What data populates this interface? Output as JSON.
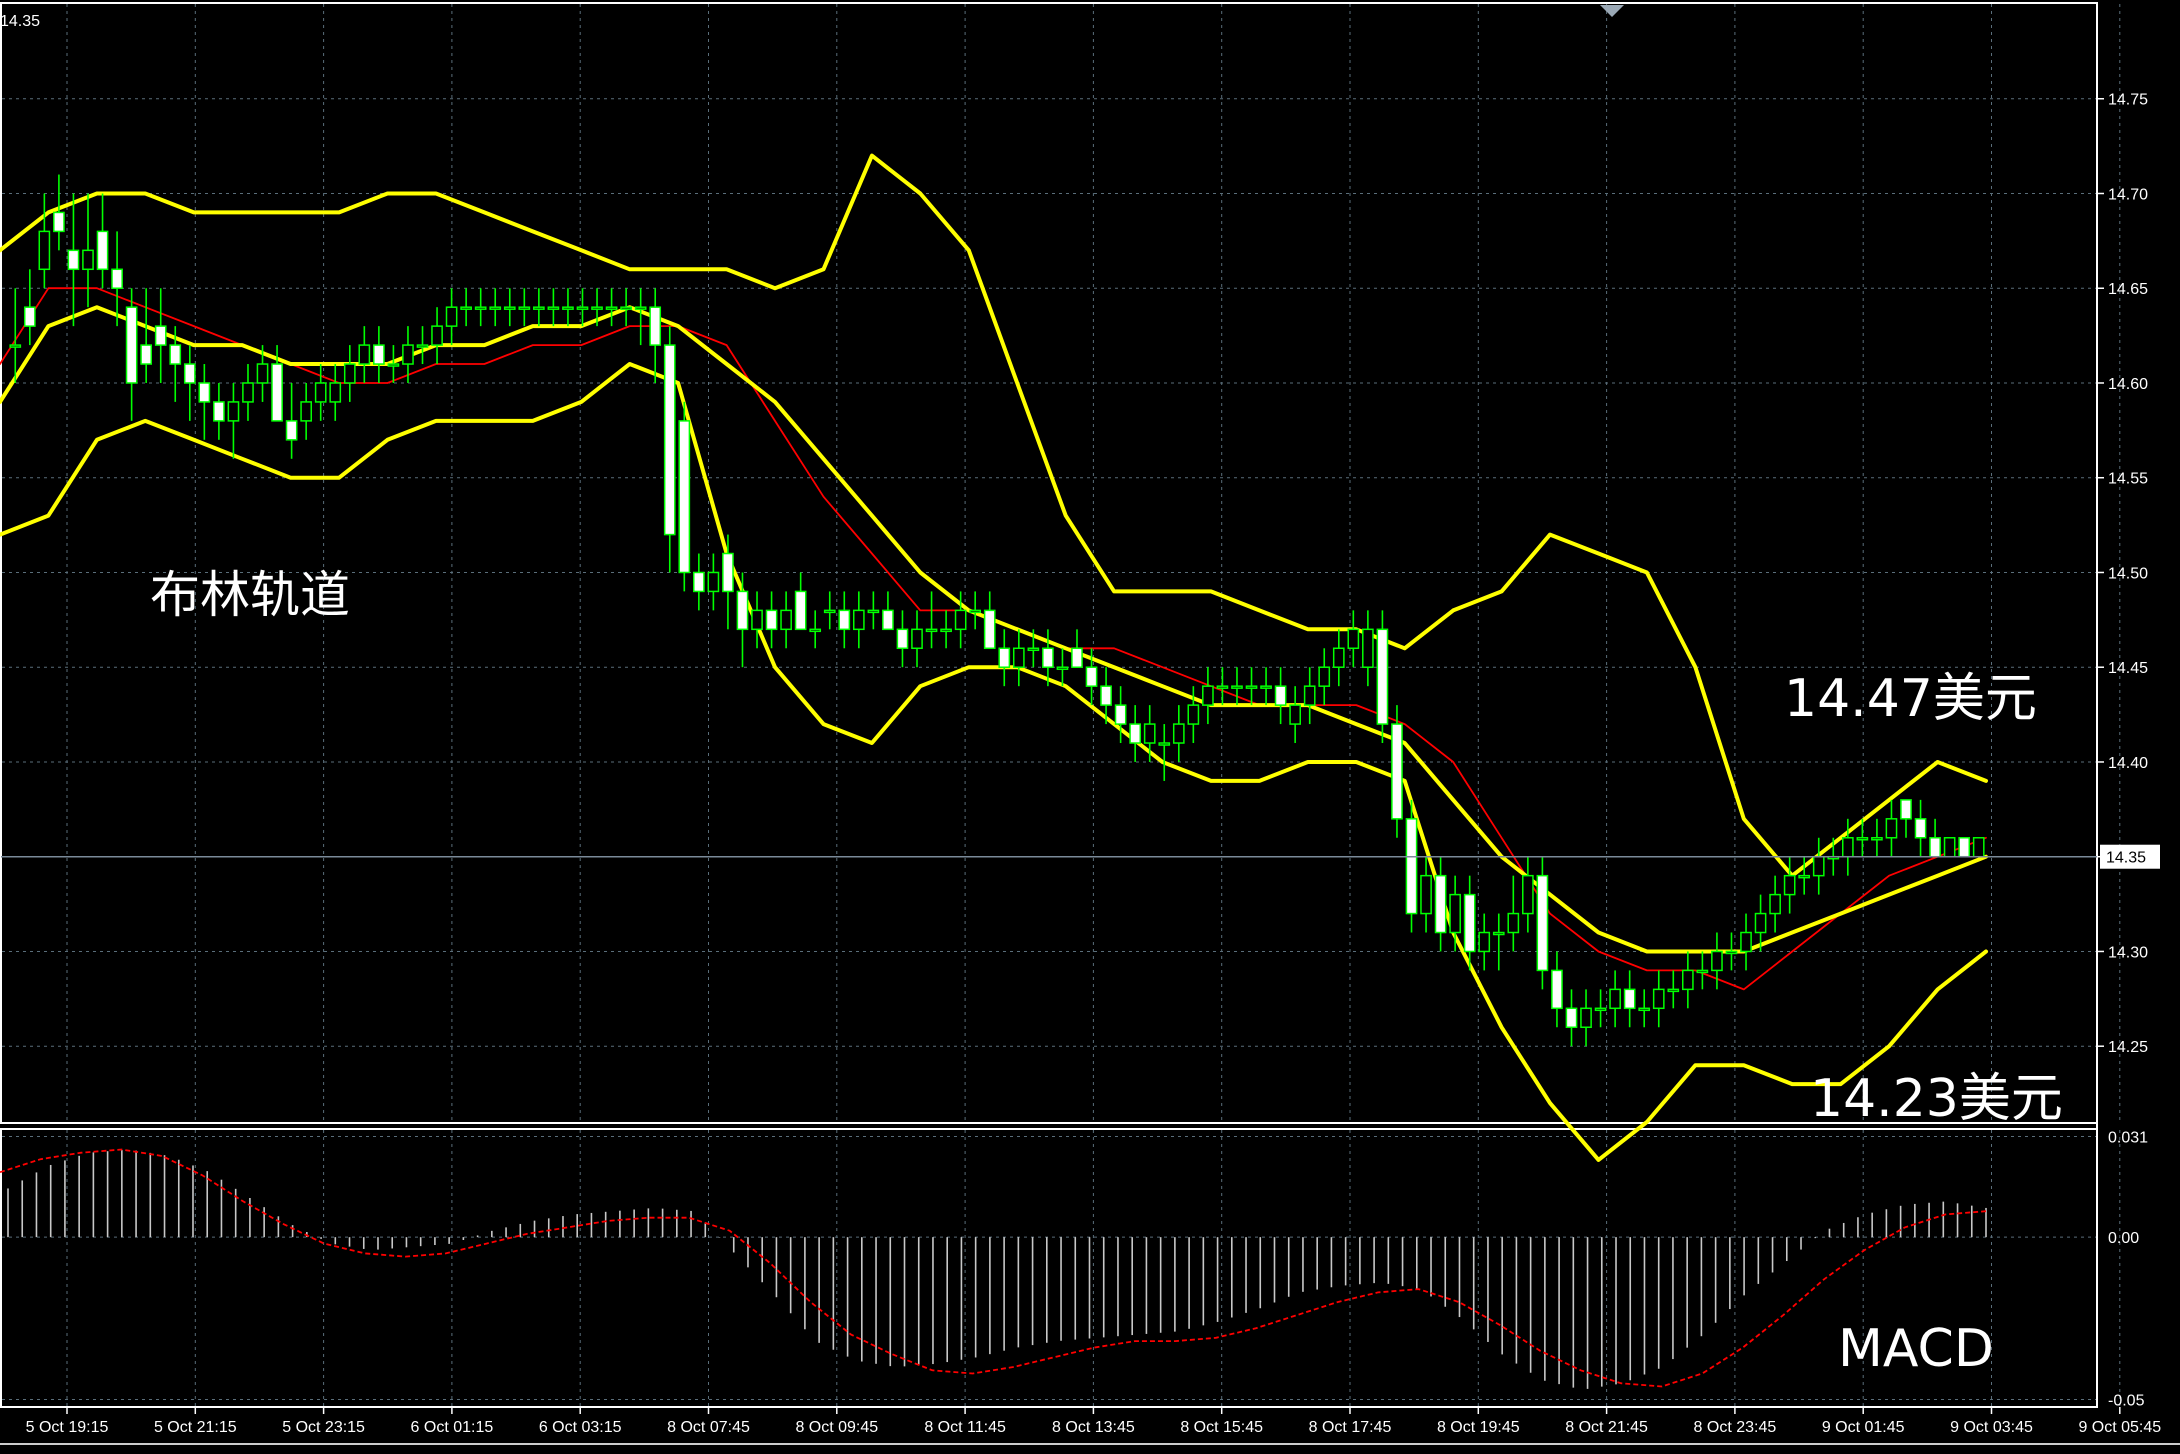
{
  "colors": {
    "background": "#000000",
    "grid": "#5a6e7a",
    "frame": "#ffffff",
    "candle": "#00ff00",
    "bollinger": "#ffff00",
    "moving_average": "#ff0000",
    "macd_histogram": "#c8c8c8",
    "macd_signal": "#ff0000",
    "price_line": "#7a8a99"
  },
  "price_panel": {
    "top_label": "14.35",
    "y_ticks": [
      "14.75",
      "14.70",
      "14.65",
      "14.60",
      "14.55",
      "14.50",
      "14.45",
      "14.40",
      "14.35",
      "14.30",
      "14.25"
    ],
    "current_price": "14.35",
    "annotations": {
      "bollinger_label": "布林轨道",
      "upper_price_label": "14.47美元",
      "lower_price_label": "14.23美元"
    }
  },
  "macd_panel": {
    "label": "MACD",
    "y_ticks": [
      "0.031",
      "0.00",
      "-0.05"
    ]
  },
  "x_axis": {
    "labels": [
      "5 Oct 19:15",
      "5 Oct 21:15",
      "5 Oct 23:15",
      "6 Oct 01:15",
      "6 Oct 03:15",
      "8 Oct 07:45",
      "8 Oct 09:45",
      "8 Oct 11:45",
      "8 Oct 13:45",
      "8 Oct 15:45",
      "8 Oct 17:45",
      "8 Oct 19:45",
      "8 Oct 21:45",
      "8 Oct 23:45",
      "9 Oct 01:45",
      "9 Oct 03:45",
      "9 Oct 05:45"
    ]
  },
  "chart_data": {
    "type": "candlestick",
    "instrument_timeframe": "M15",
    "ylim": [
      14.21,
      14.8
    ],
    "candles": [
      {
        "o": 14.62,
        "h": 14.65,
        "l": 14.6,
        "c": 14.62
      },
      {
        "o": 14.64,
        "h": 14.66,
        "l": 14.62,
        "c": 14.63
      },
      {
        "o": 14.66,
        "h": 14.7,
        "l": 14.65,
        "c": 14.68
      },
      {
        "o": 14.69,
        "h": 14.71,
        "l": 14.67,
        "c": 14.68
      },
      {
        "o": 14.67,
        "h": 14.7,
        "l": 14.63,
        "c": 14.66
      },
      {
        "o": 14.66,
        "h": 14.7,
        "l": 14.64,
        "c": 14.67
      },
      {
        "o": 14.68,
        "h": 14.7,
        "l": 14.65,
        "c": 14.66
      },
      {
        "o": 14.66,
        "h": 14.68,
        "l": 14.63,
        "c": 14.65
      },
      {
        "o": 14.64,
        "h": 14.65,
        "l": 14.58,
        "c": 14.6
      },
      {
        "o": 14.62,
        "h": 14.65,
        "l": 14.6,
        "c": 14.61
      },
      {
        "o": 14.63,
        "h": 14.65,
        "l": 14.6,
        "c": 14.62
      },
      {
        "o": 14.62,
        "h": 14.63,
        "l": 14.59,
        "c": 14.61
      },
      {
        "o": 14.61,
        "h": 14.62,
        "l": 14.58,
        "c": 14.6
      },
      {
        "o": 14.6,
        "h": 14.61,
        "l": 14.57,
        "c": 14.59
      },
      {
        "o": 14.59,
        "h": 14.6,
        "l": 14.57,
        "c": 14.58
      },
      {
        "o": 14.58,
        "h": 14.6,
        "l": 14.56,
        "c": 14.59
      },
      {
        "o": 14.59,
        "h": 14.61,
        "l": 14.58,
        "c": 14.6
      },
      {
        "o": 14.6,
        "h": 14.62,
        "l": 14.59,
        "c": 14.61
      },
      {
        "o": 14.61,
        "h": 14.62,
        "l": 14.58,
        "c": 14.58
      },
      {
        "o": 14.58,
        "h": 14.6,
        "l": 14.56,
        "c": 14.57
      },
      {
        "o": 14.58,
        "h": 14.6,
        "l": 14.57,
        "c": 14.59
      },
      {
        "o": 14.59,
        "h": 14.61,
        "l": 14.58,
        "c": 14.6
      },
      {
        "o": 14.59,
        "h": 14.61,
        "l": 14.58,
        "c": 14.6
      },
      {
        "o": 14.6,
        "h": 14.62,
        "l": 14.59,
        "c": 14.61
      },
      {
        "o": 14.61,
        "h": 14.63,
        "l": 14.6,
        "c": 14.62
      },
      {
        "o": 14.62,
        "h": 14.63,
        "l": 14.6,
        "c": 14.61
      },
      {
        "o": 14.61,
        "h": 14.62,
        "l": 14.6,
        "c": 14.61
      },
      {
        "o": 14.61,
        "h": 14.63,
        "l": 14.6,
        "c": 14.62
      },
      {
        "o": 14.62,
        "h": 14.63,
        "l": 14.61,
        "c": 14.62
      },
      {
        "o": 14.62,
        "h": 14.64,
        "l": 14.61,
        "c": 14.63
      },
      {
        "o": 14.63,
        "h": 14.65,
        "l": 14.62,
        "c": 14.64
      },
      {
        "o": 14.64,
        "h": 14.65,
        "l": 14.63,
        "c": 14.64
      },
      {
        "o": 14.64,
        "h": 14.65,
        "l": 14.63,
        "c": 14.64
      },
      {
        "o": 14.64,
        "h": 14.65,
        "l": 14.63,
        "c": 14.64
      },
      {
        "o": 14.64,
        "h": 14.65,
        "l": 14.63,
        "c": 14.64
      },
      {
        "o": 14.64,
        "h": 14.65,
        "l": 14.63,
        "c": 14.64
      },
      {
        "o": 14.64,
        "h": 14.65,
        "l": 14.63,
        "c": 14.64
      },
      {
        "o": 14.64,
        "h": 14.65,
        "l": 14.63,
        "c": 14.64
      },
      {
        "o": 14.64,
        "h": 14.65,
        "l": 14.63,
        "c": 14.64
      },
      {
        "o": 14.64,
        "h": 14.65,
        "l": 14.63,
        "c": 14.64
      },
      {
        "o": 14.64,
        "h": 14.65,
        "l": 14.63,
        "c": 14.64
      },
      {
        "o": 14.64,
        "h": 14.65,
        "l": 14.63,
        "c": 14.64
      },
      {
        "o": 14.64,
        "h": 14.65,
        "l": 14.63,
        "c": 14.64
      },
      {
        "o": 14.64,
        "h": 14.65,
        "l": 14.62,
        "c": 14.64
      },
      {
        "o": 14.64,
        "h": 14.65,
        "l": 14.6,
        "c": 14.62
      },
      {
        "o": 14.62,
        "h": 14.63,
        "l": 14.5,
        "c": 14.52
      },
      {
        "o": 14.58,
        "h": 14.59,
        "l": 14.49,
        "c": 14.5
      },
      {
        "o": 14.5,
        "h": 14.51,
        "l": 14.48,
        "c": 14.49
      },
      {
        "o": 14.49,
        "h": 14.51,
        "l": 14.48,
        "c": 14.5
      },
      {
        "o": 14.51,
        "h": 14.52,
        "l": 14.47,
        "c": 14.49
      },
      {
        "o": 14.49,
        "h": 14.5,
        "l": 14.45,
        "c": 14.47
      },
      {
        "o": 14.47,
        "h": 14.49,
        "l": 14.46,
        "c": 14.48
      },
      {
        "o": 14.48,
        "h": 14.49,
        "l": 14.46,
        "c": 14.47
      },
      {
        "o": 14.47,
        "h": 14.49,
        "l": 14.46,
        "c": 14.48
      },
      {
        "o": 14.49,
        "h": 14.5,
        "l": 14.47,
        "c": 14.47
      },
      {
        "o": 14.47,
        "h": 14.48,
        "l": 14.46,
        "c": 14.47
      },
      {
        "o": 14.48,
        "h": 14.49,
        "l": 14.47,
        "c": 14.48
      },
      {
        "o": 14.48,
        "h": 14.49,
        "l": 14.46,
        "c": 14.47
      },
      {
        "o": 14.47,
        "h": 14.49,
        "l": 14.46,
        "c": 14.48
      },
      {
        "o": 14.48,
        "h": 14.49,
        "l": 14.47,
        "c": 14.48
      },
      {
        "o": 14.48,
        "h": 14.49,
        "l": 14.47,
        "c": 14.47
      },
      {
        "o": 14.47,
        "h": 14.48,
        "l": 14.45,
        "c": 14.46
      },
      {
        "o": 14.46,
        "h": 14.48,
        "l": 14.45,
        "c": 14.47
      },
      {
        "o": 14.47,
        "h": 14.49,
        "l": 14.46,
        "c": 14.47
      },
      {
        "o": 14.47,
        "h": 14.48,
        "l": 14.46,
        "c": 14.47
      },
      {
        "o": 14.47,
        "h": 14.49,
        "l": 14.46,
        "c": 14.48
      },
      {
        "o": 14.48,
        "h": 14.49,
        "l": 14.47,
        "c": 14.48
      },
      {
        "o": 14.48,
        "h": 14.49,
        "l": 14.46,
        "c": 14.46
      },
      {
        "o": 14.46,
        "h": 14.47,
        "l": 14.44,
        "c": 14.45
      },
      {
        "o": 14.45,
        "h": 14.47,
        "l": 14.44,
        "c": 14.46
      },
      {
        "o": 14.46,
        "h": 14.47,
        "l": 14.45,
        "c": 14.46
      },
      {
        "o": 14.46,
        "h": 14.47,
        "l": 14.44,
        "c": 14.45
      },
      {
        "o": 14.45,
        "h": 14.46,
        "l": 14.44,
        "c": 14.45
      },
      {
        "o": 14.46,
        "h": 14.47,
        "l": 14.45,
        "c": 14.45
      },
      {
        "o": 14.45,
        "h": 14.46,
        "l": 14.43,
        "c": 14.44
      },
      {
        "o": 14.44,
        "h": 14.45,
        "l": 14.42,
        "c": 14.43
      },
      {
        "o": 14.43,
        "h": 14.44,
        "l": 14.41,
        "c": 14.42
      },
      {
        "o": 14.42,
        "h": 14.43,
        "l": 14.4,
        "c": 14.41
      },
      {
        "o": 14.41,
        "h": 14.43,
        "l": 14.4,
        "c": 14.42
      },
      {
        "o": 14.41,
        "h": 14.42,
        "l": 14.39,
        "c": 14.41
      },
      {
        "o": 14.41,
        "h": 14.43,
        "l": 14.4,
        "c": 14.42
      },
      {
        "o": 14.42,
        "h": 14.44,
        "l": 14.41,
        "c": 14.43
      },
      {
        "o": 14.43,
        "h": 14.45,
        "l": 14.42,
        "c": 14.44
      },
      {
        "o": 14.44,
        "h": 14.45,
        "l": 14.43,
        "c": 14.44
      },
      {
        "o": 14.44,
        "h": 14.45,
        "l": 14.43,
        "c": 14.44
      },
      {
        "o": 14.44,
        "h": 14.45,
        "l": 14.43,
        "c": 14.44
      },
      {
        "o": 14.44,
        "h": 14.45,
        "l": 14.43,
        "c": 14.44
      },
      {
        "o": 14.44,
        "h": 14.45,
        "l": 14.42,
        "c": 14.43
      },
      {
        "o": 14.42,
        "h": 14.44,
        "l": 14.41,
        "c": 14.43
      },
      {
        "o": 14.43,
        "h": 14.45,
        "l": 14.42,
        "c": 14.44
      },
      {
        "o": 14.44,
        "h": 14.46,
        "l": 14.43,
        "c": 14.45
      },
      {
        "o": 14.45,
        "h": 14.47,
        "l": 14.44,
        "c": 14.46
      },
      {
        "o": 14.46,
        "h": 14.48,
        "l": 14.45,
        "c": 14.47
      },
      {
        "o": 14.45,
        "h": 14.48,
        "l": 14.44,
        "c": 14.47
      },
      {
        "o": 14.47,
        "h": 14.48,
        "l": 14.41,
        "c": 14.42
      },
      {
        "o": 14.42,
        "h": 14.43,
        "l": 14.36,
        "c": 14.37
      },
      {
        "o": 14.37,
        "h": 14.38,
        "l": 14.31,
        "c": 14.32
      },
      {
        "o": 14.32,
        "h": 14.35,
        "l": 14.31,
        "c": 14.34
      },
      {
        "o": 14.34,
        "h": 14.35,
        "l": 14.3,
        "c": 14.31
      },
      {
        "o": 14.31,
        "h": 14.34,
        "l": 14.3,
        "c": 14.33
      },
      {
        "o": 14.33,
        "h": 14.34,
        "l": 14.29,
        "c": 14.3
      },
      {
        "o": 14.3,
        "h": 14.32,
        "l": 14.29,
        "c": 14.31
      },
      {
        "o": 14.31,
        "h": 14.32,
        "l": 14.29,
        "c": 14.31
      },
      {
        "o": 14.31,
        "h": 14.34,
        "l": 14.3,
        "c": 14.32
      },
      {
        "o": 14.32,
        "h": 14.35,
        "l": 14.31,
        "c": 14.34
      },
      {
        "o": 14.34,
        "h": 14.35,
        "l": 14.28,
        "c": 14.29
      },
      {
        "o": 14.29,
        "h": 14.3,
        "l": 14.26,
        "c": 14.27
      },
      {
        "o": 14.27,
        "h": 14.28,
        "l": 14.25,
        "c": 14.26
      },
      {
        "o": 14.26,
        "h": 14.28,
        "l": 14.25,
        "c": 14.27
      },
      {
        "o": 14.27,
        "h": 14.28,
        "l": 14.26,
        "c": 14.27
      },
      {
        "o": 14.27,
        "h": 14.29,
        "l": 14.26,
        "c": 14.28
      },
      {
        "o": 14.28,
        "h": 14.29,
        "l": 14.26,
        "c": 14.27
      },
      {
        "o": 14.27,
        "h": 14.28,
        "l": 14.26,
        "c": 14.27
      },
      {
        "o": 14.27,
        "h": 14.29,
        "l": 14.26,
        "c": 14.28
      },
      {
        "o": 14.28,
        "h": 14.29,
        "l": 14.27,
        "c": 14.28
      },
      {
        "o": 14.28,
        "h": 14.3,
        "l": 14.27,
        "c": 14.29
      },
      {
        "o": 14.29,
        "h": 14.3,
        "l": 14.28,
        "c": 14.29
      },
      {
        "o": 14.29,
        "h": 14.31,
        "l": 14.28,
        "c": 14.3
      },
      {
        "o": 14.3,
        "h": 14.31,
        "l": 14.29,
        "c": 14.3
      },
      {
        "o": 14.3,
        "h": 14.32,
        "l": 14.29,
        "c": 14.31
      },
      {
        "o": 14.31,
        "h": 14.33,
        "l": 14.3,
        "c": 14.32
      },
      {
        "o": 14.32,
        "h": 14.34,
        "l": 14.31,
        "c": 14.33
      },
      {
        "o": 14.33,
        "h": 14.35,
        "l": 14.32,
        "c": 14.34
      },
      {
        "o": 14.34,
        "h": 14.35,
        "l": 14.33,
        "c": 14.34
      },
      {
        "o": 14.34,
        "h": 14.36,
        "l": 14.33,
        "c": 14.35
      },
      {
        "o": 14.35,
        "h": 14.36,
        "l": 14.34,
        "c": 14.35
      },
      {
        "o": 14.35,
        "h": 14.37,
        "l": 14.34,
        "c": 14.36
      },
      {
        "o": 14.36,
        "h": 14.37,
        "l": 14.35,
        "c": 14.36
      },
      {
        "o": 14.36,
        "h": 14.37,
        "l": 14.35,
        "c": 14.36
      },
      {
        "o": 14.36,
        "h": 14.38,
        "l": 14.35,
        "c": 14.37
      },
      {
        "o": 14.38,
        "h": 14.38,
        "l": 14.36,
        "c": 14.37
      },
      {
        "o": 14.37,
        "h": 14.38,
        "l": 14.35,
        "c": 14.36
      },
      {
        "o": 14.36,
        "h": 14.37,
        "l": 14.35,
        "c": 14.35
      },
      {
        "o": 14.35,
        "h": 14.36,
        "l": 14.35,
        "c": 14.36
      },
      {
        "o": 14.36,
        "h": 14.36,
        "l": 14.35,
        "c": 14.35
      },
      {
        "o": 14.35,
        "h": 14.36,
        "l": 14.35,
        "c": 14.36
      }
    ],
    "bollinger_upper": [
      14.67,
      14.69,
      14.7,
      14.7,
      14.69,
      14.69,
      14.69,
      14.69,
      14.7,
      14.7,
      14.69,
      14.68,
      14.67,
      14.66,
      14.66,
      14.66,
      14.65,
      14.66,
      14.72,
      14.7,
      14.67,
      14.6,
      14.53,
      14.49,
      14.49,
      14.49,
      14.48,
      14.47,
      14.47,
      14.46,
      14.48,
      14.49,
      14.52,
      14.51,
      14.5,
      14.45,
      14.37,
      14.34,
      14.36,
      14.38,
      14.4,
      14.39
    ],
    "bollinger_middle": [
      14.59,
      14.63,
      14.64,
      14.63,
      14.62,
      14.62,
      14.61,
      14.61,
      14.61,
      14.62,
      14.62,
      14.63,
      14.63,
      14.64,
      14.63,
      14.61,
      14.59,
      14.56,
      14.53,
      14.5,
      14.48,
      14.47,
      14.46,
      14.45,
      14.44,
      14.43,
      14.43,
      14.43,
      14.42,
      14.41,
      14.38,
      14.35,
      14.33,
      14.31,
      14.3,
      14.3,
      14.3,
      14.31,
      14.32,
      14.33,
      14.34,
      14.35
    ],
    "bollinger_lower": [
      14.52,
      14.53,
      14.57,
      14.58,
      14.57,
      14.56,
      14.55,
      14.55,
      14.57,
      14.58,
      14.58,
      14.58,
      14.59,
      14.61,
      14.6,
      14.51,
      14.45,
      14.42,
      14.41,
      14.44,
      14.45,
      14.45,
      14.44,
      14.42,
      14.4,
      14.39,
      14.39,
      14.4,
      14.4,
      14.39,
      14.31,
      14.26,
      14.22,
      14.19,
      14.21,
      14.24,
      14.24,
      14.23,
      14.23,
      14.25,
      14.28,
      14.3
    ],
    "moving_average": [
      14.61,
      14.65,
      14.65,
      14.64,
      14.63,
      14.62,
      14.61,
      14.6,
      14.6,
      14.61,
      14.61,
      14.62,
      14.62,
      14.63,
      14.63,
      14.62,
      14.58,
      14.54,
      14.51,
      14.48,
      14.48,
      14.47,
      14.46,
      14.46,
      14.45,
      14.44,
      14.43,
      14.43,
      14.43,
      14.42,
      14.4,
      14.36,
      14.32,
      14.3,
      14.29,
      14.29,
      14.28,
      14.3,
      14.32,
      14.34,
      14.35,
      14.36
    ],
    "macd": {
      "ylim": [
        -0.052,
        0.033
      ],
      "histogram": [
        0.015,
        0.022,
        0.026,
        0.027,
        0.025,
        0.02,
        0.012,
        0.004,
        -0.002,
        -0.004,
        -0.003,
        -0.002,
        0.002,
        0.005,
        0.007,
        0.008,
        0.009,
        0.008,
        -0.005,
        -0.018,
        -0.032,
        -0.038,
        -0.04,
        -0.039,
        -0.037,
        -0.034,
        -0.032,
        -0.031,
        -0.03,
        -0.029,
        -0.026,
        -0.022,
        -0.017,
        -0.015,
        -0.014,
        -0.016,
        -0.025,
        -0.036,
        -0.044,
        -0.047,
        -0.045,
        -0.04,
        -0.03,
        -0.018,
        -0.008,
        0.002,
        0.007,
        0.01,
        0.011,
        0.009
      ],
      "signal": [
        0.02,
        0.024,
        0.026,
        0.027,
        0.025,
        0.019,
        0.011,
        0.004,
        -0.002,
        -0.005,
        -0.006,
        -0.005,
        -0.002,
        0.001,
        0.003,
        0.005,
        0.006,
        0.006,
        0.002,
        -0.008,
        -0.02,
        -0.03,
        -0.036,
        -0.041,
        -0.042,
        -0.04,
        -0.037,
        -0.034,
        -0.032,
        -0.032,
        -0.031,
        -0.028,
        -0.024,
        -0.02,
        -0.017,
        -0.016,
        -0.02,
        -0.027,
        -0.035,
        -0.041,
        -0.045,
        -0.046,
        -0.042,
        -0.034,
        -0.024,
        -0.013,
        -0.004,
        0.003,
        0.007,
        0.008
      ]
    }
  }
}
